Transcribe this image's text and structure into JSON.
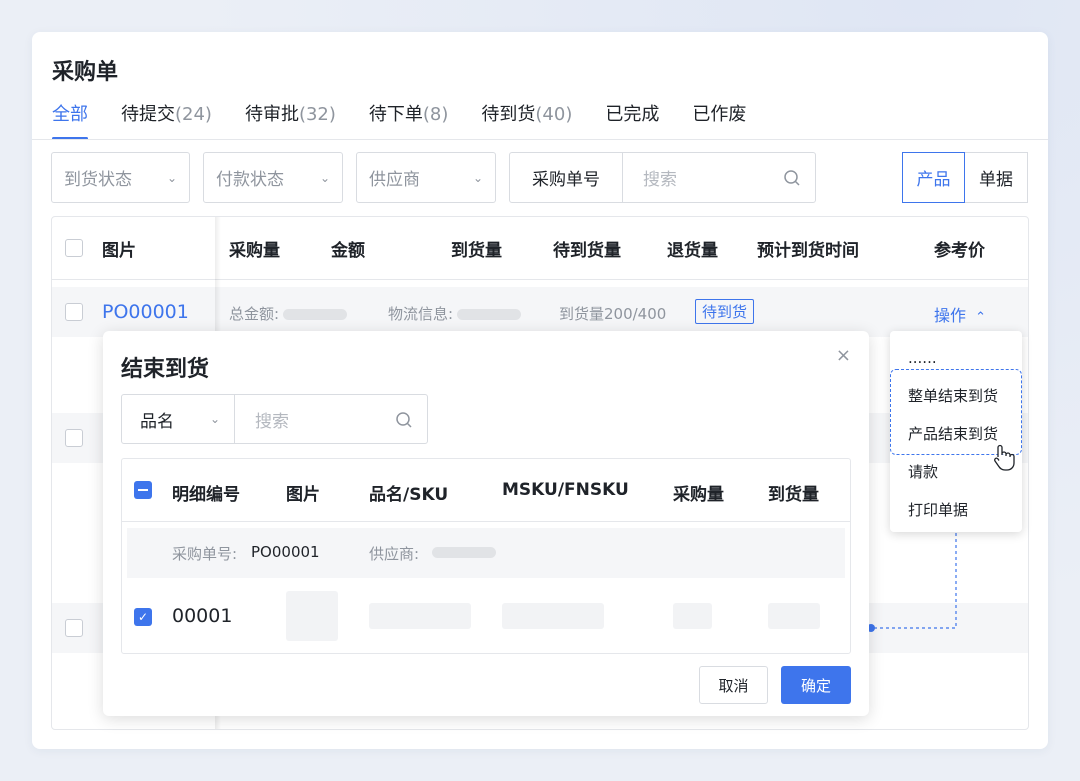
{
  "page": {
    "title": "采购单"
  },
  "tabs": [
    {
      "label": "全部",
      "count": ""
    },
    {
      "label": "待提交",
      "count": "(24)"
    },
    {
      "label": "待审批",
      "count": "(32)"
    },
    {
      "label": "待下单",
      "count": "(8)"
    },
    {
      "label": "待到货",
      "count": "(40)"
    },
    {
      "label": "已完成",
      "count": ""
    },
    {
      "label": "已作废",
      "count": ""
    }
  ],
  "filters": {
    "arrival_status": "到货状态",
    "payment_status": "付款状态",
    "supplier": "供应商"
  },
  "search": {
    "field": "采购单号",
    "placeholder": "搜索"
  },
  "view_toggle": {
    "product": "产品",
    "document": "单据"
  },
  "table": {
    "headers": [
      "图片",
      "采购量",
      "金额",
      "到货量",
      "待到货量",
      "退货量",
      "预计到货时间",
      "参考价"
    ],
    "row": {
      "po": "PO00001",
      "total_label": "总金额:",
      "logistics_label": "物流信息:",
      "arrival": "到货量200/400",
      "status": "待到货",
      "ops": "操作"
    }
  },
  "menu": {
    "items": [
      "......",
      "整单结束到货",
      "产品结束到货",
      "请款",
      "打印单据"
    ]
  },
  "modal": {
    "title": "结束到货",
    "close": "×",
    "select": {
      "value": "品名",
      "placeholder": "搜索"
    },
    "headers": [
      "明细编号",
      "图片",
      "品名/SKU",
      "MSKU/FNSKU",
      "采购量",
      "到货量"
    ],
    "group": {
      "po_label": "采购单号:",
      "po_value": "PO00001",
      "supplier_label": "供应商:"
    },
    "item": {
      "id": "00001"
    },
    "cancel": "取消",
    "confirm": "确定"
  },
  "colors": {
    "accent": "#3e75ec",
    "background": "#ebeff6"
  },
  "icons": [
    "search-icon",
    "chevron-down-icon",
    "chevron-up-icon",
    "close-icon",
    "pointer-hand-icon",
    "check-icon",
    "indeterminate-icon"
  ]
}
